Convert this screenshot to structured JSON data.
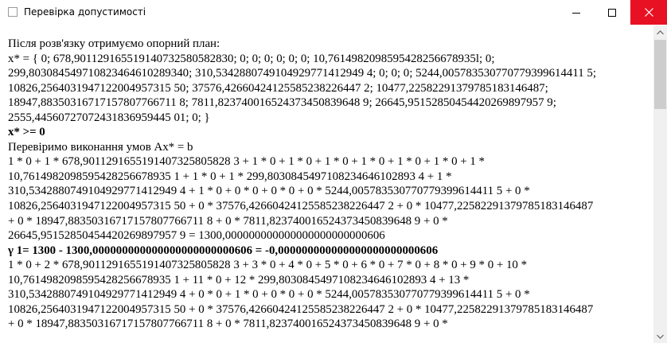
{
  "window": {
    "title": "Перевірка допустимості"
  },
  "content": {
    "lines": [
      {
        "text": "Після розв'язку отримуємо опорний план:",
        "bold": false
      },
      {
        "text": "x* = { 0; 678,901129165519140732580582830; 0; 0; 0; 0; 0; 0; 10,7614982098595428256678935l; 0;",
        "bold": false
      },
      {
        "text": "299,803084549710823464610289340; 310,5342880749104929771412949 4; 0; 0; 0; 5244,005783530770779399614411 5;",
        "bold": false
      },
      {
        "text": "10826,2564031947122004957315 50; 37576,42660424125585238226447 2; 10477,22582291379785183146487;",
        "bold": false
      },
      {
        "text": "18947,88350316717157807766711 8; 7811,823740016524373450839648 9; 26645,95152850454420269897957 9;",
        "bold": false
      },
      {
        "text": "2555,44560727072431836959445 01; 0; }",
        "bold": false
      },
      {
        "text": "x* >= 0",
        "bold": true
      },
      {
        "text": "Перевіримо виконання умов Ax* = b",
        "bold": false
      },
      {
        "text": "1 * 0 + 1 * 678,9011291655191407325805828 3 + 1 * 0 + 1 * 0 + 1 * 0 + 1 * 0 + 1 * 0 + 1 * 0 + 1 *",
        "bold": false
      },
      {
        "text": "10,7614982098595428256678935 1 + 1 * 0 + 1 * 299,8030845497108234646102893 4 + 1 *",
        "bold": false
      },
      {
        "text": "310,5342880749104929771412949 4 + 1 * 0 + 0 * 0 + 0 * 0 + 0 * 5244,005783530770779399614411 5 + 0 *",
        "bold": false
      },
      {
        "text": "10826,2564031947122004957315 50 + 0 * 37576,42660424125585238226447 2 + 0 * 10477,22582291379785183146487",
        "bold": false
      },
      {
        "text": "+ 0 * 18947,88350316717157807766711 8 + 0 * 7811,823740016524373450839648 9 + 0 *",
        "bold": false
      },
      {
        "text": "26645,95152850454420269897957 9 = 1300,000000000000000000000000606",
        "bold": false
      },
      {
        "text": "γ 1= 1300 - 1300,000000000000000000000000606 = -0,000000000000000000000000606",
        "bold": true
      },
      {
        "text": "1 * 0 + 2 * 678,9011291655191407325805828 3 + 3 * 0 + 4 * 0 + 5 * 0 + 6 * 0 + 7 * 0 + 8 * 0 + 9 * 0 + 10 *",
        "bold": false
      },
      {
        "text": "10,7614982098595428256678935 1 + 11 * 0 + 12 * 299,8030845497108234646102893 4 + 13 *",
        "bold": false
      },
      {
        "text": "310,5342880749104929771412949 4 + 0 * 0 + 1 * 0 + 0 * 0 + 0 * 5244,005783530770779399614411 5 + 0 *",
        "bold": false
      },
      {
        "text": "10826,2564031947122004957315 50 + 0 * 37576,42660424125585238226447 2 + 0 * 10477,22582291379785183146487",
        "bold": false
      },
      {
        "text": "+ 0 * 18947,88350316717157807766711 8 + 0 * 7811,823740016524373450839648 9 + 0 *",
        "bold": false
      }
    ]
  },
  "icons": {
    "app": "window-app-icon",
    "minimize": "minimize-icon",
    "maximize": "maximize-icon",
    "close": "close-icon",
    "scroll_up": "scroll-up-arrow-icon",
    "scroll_down": "scroll-down-arrow-icon"
  },
  "colors": {
    "close_button": "#e81123",
    "scrollbar_track": "#f0f0f0",
    "scrollbar_thumb": "#cdcdcd"
  },
  "scrollbar": {
    "position_fraction": 0.0
  }
}
